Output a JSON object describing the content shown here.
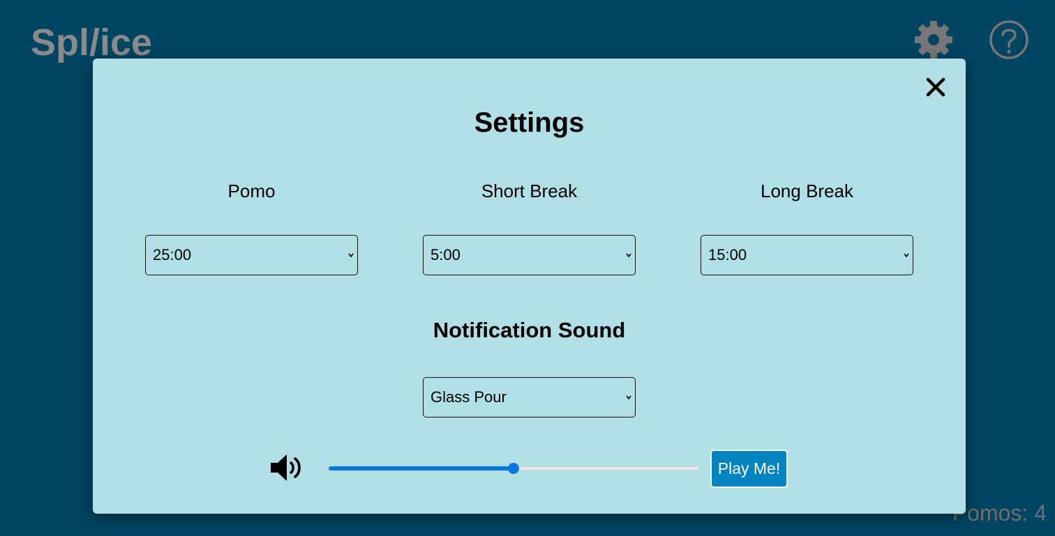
{
  "app": {
    "title": "Spl/ice",
    "pomos_label": "Pomos: 4"
  },
  "header": {
    "icons": [
      "gear-icon",
      "help-icon"
    ]
  },
  "modal": {
    "title": "Settings",
    "close_icon": "close-icon",
    "timers": [
      {
        "label": "Pomo",
        "selected": "25:00"
      },
      {
        "label": "Short Break",
        "selected": "5:00"
      },
      {
        "label": "Long Break",
        "selected": "15:00"
      }
    ],
    "notification": {
      "title": "Notification Sound",
      "selected": "Glass Pour"
    },
    "volume": {
      "icon": "volume-icon",
      "level_percent": 50
    },
    "play_button_label": "Play Me!"
  },
  "colors": {
    "page_background": "#004561",
    "modal_background": "#b0dfe5",
    "accent": "#0b75e2",
    "button": "#0284c1",
    "muted_text": "#8a8a8a"
  }
}
